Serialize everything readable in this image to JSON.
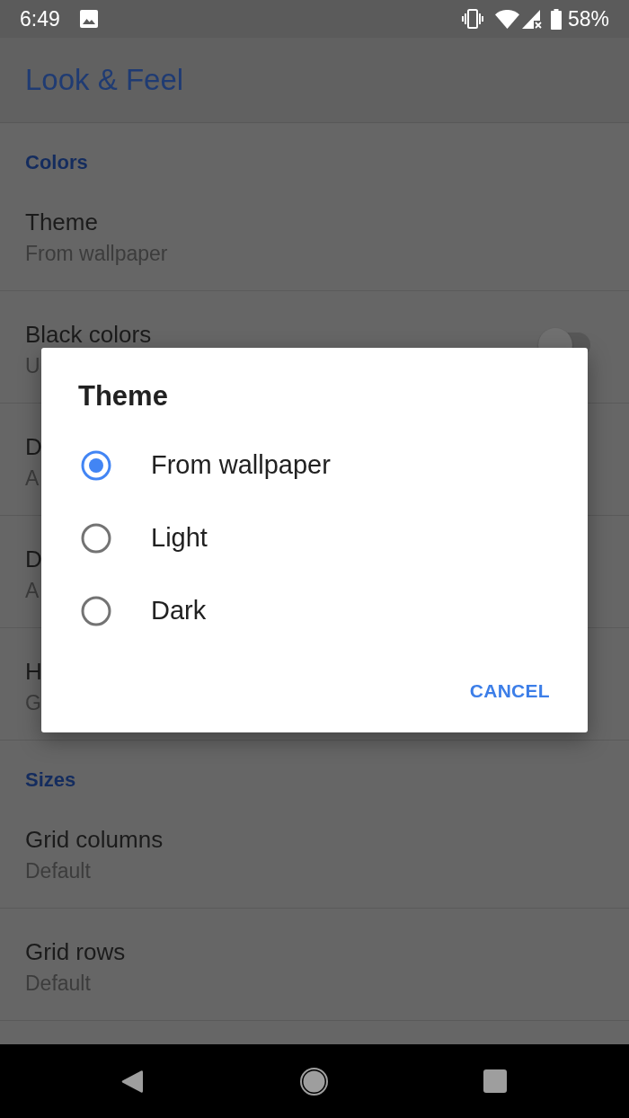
{
  "status_bar": {
    "time": "6:49",
    "battery": "58%"
  },
  "app_bar": {
    "title": "Look & Feel"
  },
  "sections": [
    {
      "header": "Colors",
      "items": [
        {
          "kind": "text",
          "title": "Theme",
          "subtitle": "From wallpaper"
        },
        {
          "kind": "switch",
          "title": "Black colors",
          "subtitle": "U",
          "on": false
        },
        {
          "kind": "text",
          "title": "D",
          "subtitle": "A"
        },
        {
          "kind": "text",
          "title": "D",
          "subtitle": "A"
        },
        {
          "kind": "text",
          "title": "H",
          "subtitle": "G"
        }
      ]
    },
    {
      "header": "Sizes",
      "items": [
        {
          "kind": "text",
          "title": "Grid columns",
          "subtitle": "Default"
        },
        {
          "kind": "text",
          "title": "Grid rows",
          "subtitle": "Default"
        }
      ]
    }
  ],
  "dialog": {
    "title": "Theme",
    "options": [
      {
        "label": "From wallpaper",
        "selected": true
      },
      {
        "label": "Light",
        "selected": false
      },
      {
        "label": "Dark",
        "selected": false
      }
    ],
    "buttons": [
      "CANCEL"
    ]
  }
}
